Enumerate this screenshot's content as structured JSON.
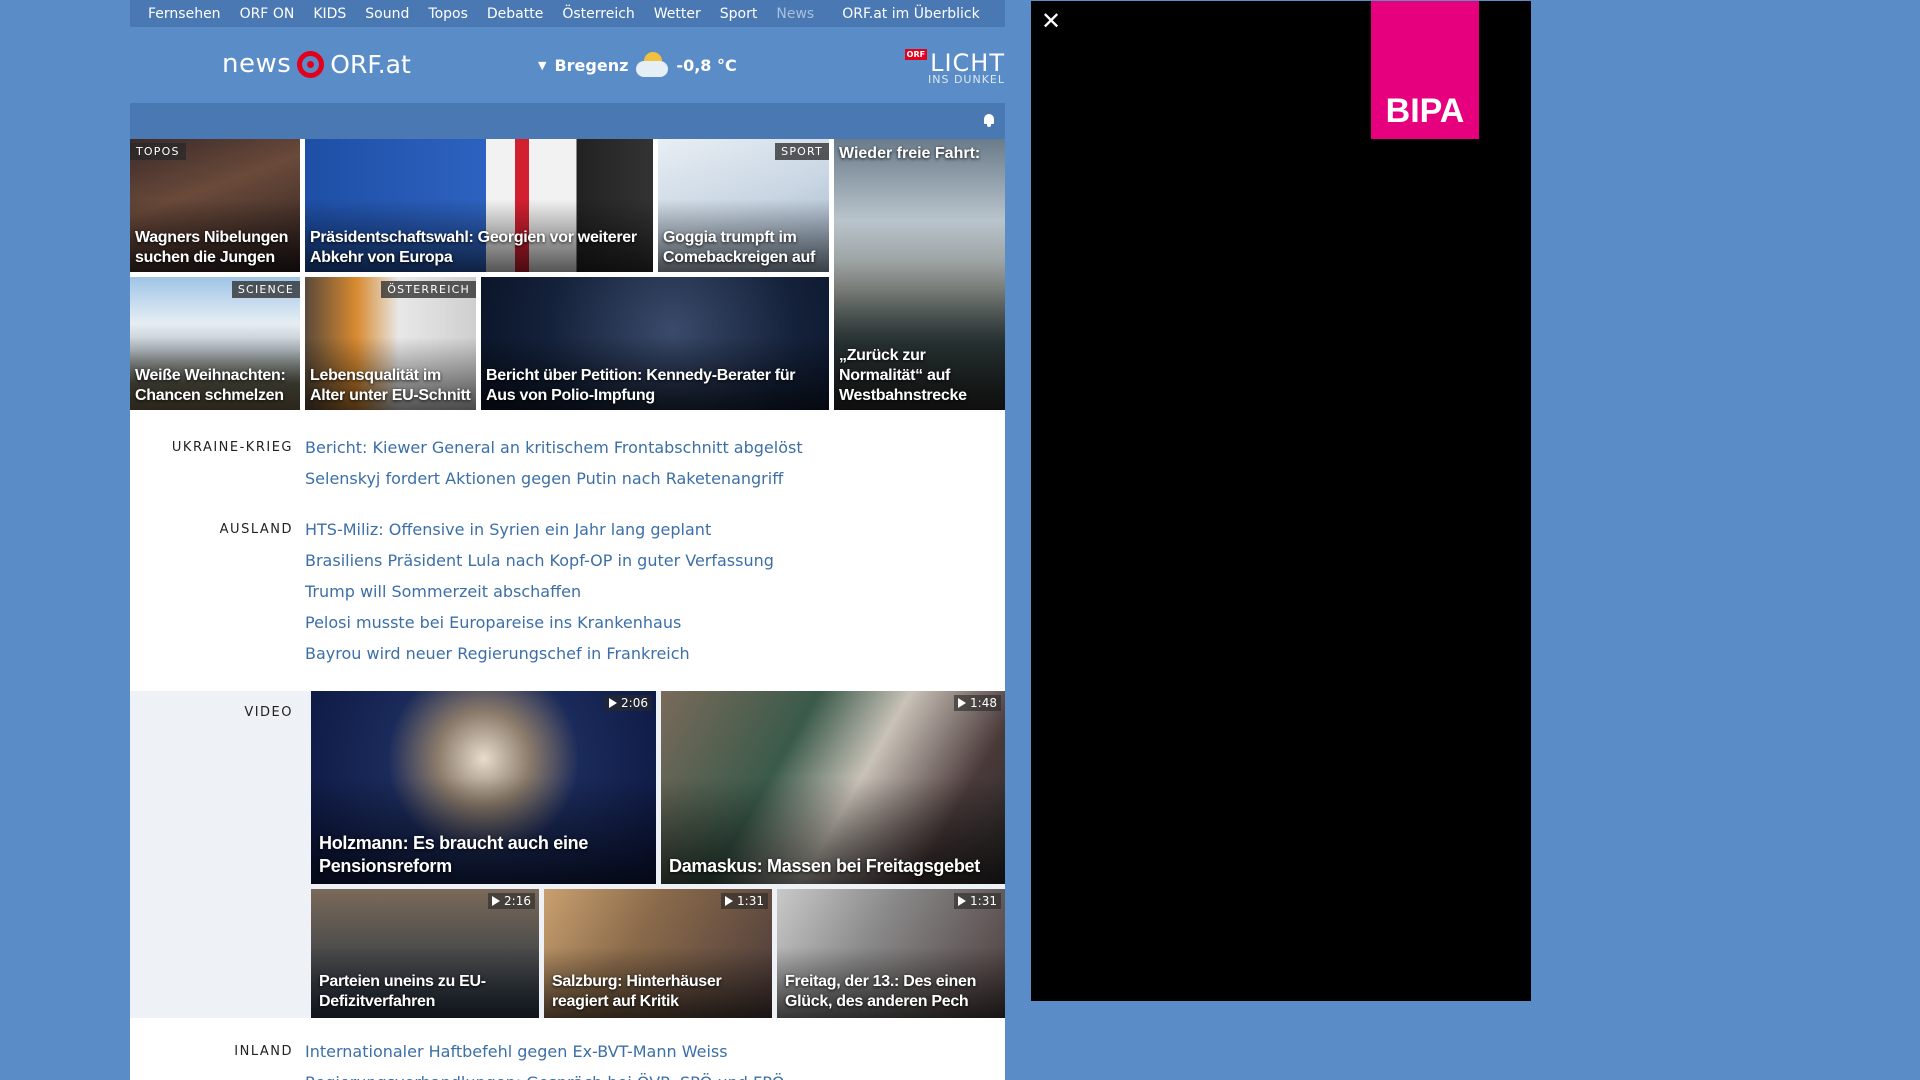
{
  "nav": {
    "items": [
      "Fernsehen",
      "ORF ON",
      "KIDS",
      "Sound",
      "Topos",
      "Debatte",
      "Österreich",
      "Wetter",
      "Sport",
      "News"
    ],
    "overview": "ORF.at im Überblick"
  },
  "header": {
    "logo_news": "news",
    "logo_orf": "ORF.at",
    "weather_location": "Bregenz",
    "weather_temp": "-0,8 °C",
    "licht_orf": "ORF",
    "licht_big": "LICHT",
    "licht_small": "INS DUNKEL"
  },
  "tiles": {
    "t1": {
      "tag": "TOPOS",
      "caption": "Wagners Nibelungen suchen die Jungen"
    },
    "t2": {
      "caption": "Präsidentschaftswahl: Georgien vor weiterer Abkehr von Europa"
    },
    "t3": {
      "tag": "SPORT",
      "caption": "Goggia trumpft im Comebackreigen auf"
    },
    "t4": {
      "topcap": "Wieder freie Fahrt:",
      "caption": "„Zurück zur Normalität“ auf Westbahnstrecke"
    },
    "t5": {
      "tag": "SCIENCE",
      "caption": "Weiße Weihnachten: Chancen schmelzen"
    },
    "t6": {
      "tag": "ÖSTERREICH",
      "caption": "Lebensqualität im Alter unter EU-Schnitt"
    },
    "t7": {
      "caption": "Bericht über Petition: Kennedy-Berater für Aus von Polio-Impfung"
    }
  },
  "sections": {
    "ukraine": {
      "label": "UKRAINE-KRIEG",
      "links": [
        "Bericht: Kiewer General an kritischem Frontabschnitt abgelöst",
        "Selenskyj fordert Aktionen gegen Putin nach Raketenangriff"
      ]
    },
    "ausland": {
      "label": "AUSLAND",
      "links": [
        "HTS-Miliz: Offensive in Syrien ein Jahr lang geplant",
        "Brasiliens Präsident Lula nach Kopf-OP in guter Verfassung",
        "Trump will Sommerzeit abschaffen",
        "Pelosi musste bei Europareise ins Krankenhaus",
        "Bayrou wird neuer Regierungschef in Frankreich"
      ]
    },
    "inland": {
      "label": "INLAND",
      "links": [
        "Internationaler Haftbefehl gegen Ex-BVT-Mann Weiss",
        "Regierungsverhandlungen: Gespräch bei ÖVP, SPÖ und FPÖ"
      ]
    }
  },
  "video": {
    "label": "VIDEO",
    "items": [
      {
        "caption": "Holzmann: Es braucht auch eine Pensionsreform",
        "duration": "2:06"
      },
      {
        "caption": "Damaskus: Massen bei Freitagsgebet",
        "duration": "1:48"
      },
      {
        "caption": "Parteien uneins zu EU-Defizitverfahren",
        "duration": "2:16"
      },
      {
        "caption": "Salzburg: Hinterhäuser reagiert auf Kritik",
        "duration": "1:31"
      },
      {
        "caption": "Freitag, der 13.: Des einen Glück, des anderen Pech",
        "duration": "1:31"
      }
    ]
  },
  "ad": {
    "close": "✕",
    "brand": "BIPA"
  },
  "colors": {
    "background": "#5a8cc8",
    "nav": "#4a78b2",
    "link": "#3c6fa8",
    "orf_red": "#e3001b",
    "bipa": "#e6007e"
  }
}
